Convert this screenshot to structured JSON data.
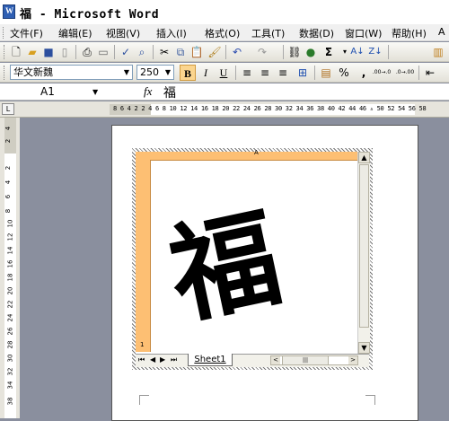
{
  "window": {
    "title": "福 - Microsoft Word"
  },
  "menu": [
    "文件(F)",
    "编辑(E)",
    "视图(V)",
    "插入(I)",
    "格式(O)",
    "工具(T)",
    "数据(D)",
    "窗口(W)",
    "帮助(H)",
    "A"
  ],
  "toolbar1": {
    "icons": [
      "new-icon",
      "open-icon",
      "save-icon",
      "permission-icon",
      "print-icon",
      "print-preview-icon",
      "spelling-icon",
      "research-icon",
      "cut-icon",
      "copy-icon",
      "paste-icon",
      "format-painter-icon",
      "undo-icon",
      "redo-icon",
      "hyperlink-icon",
      "map-icon",
      "autosum-icon",
      "sort-ascending-icon",
      "sort-descending-icon",
      "chart-icon"
    ],
    "autosum_label": "Σ"
  },
  "toolbar2": {
    "font_name": "华文新魏",
    "font_size": "250",
    "bold": "B",
    "italic": "I",
    "underline": "U",
    "percent": "%",
    "comma": ",",
    "inc_decimal": ".00→.0",
    "dec_decimal": ".0→.00"
  },
  "formula_bar": {
    "cell_ref": "A1",
    "fx": "fx",
    "value": "福"
  },
  "ruler": {
    "numbers": "8 6 4 2   2 4 6 8 10 12 14 16 18 20 22 24 26 28 30 32 34 36 38 40 42 44 46 ▵ 50 52 54 56 58"
  },
  "vruler": {
    "numbers": [
      "4",
      "2",
      "",
      "2",
      "4",
      "6",
      "8",
      "10",
      "12",
      "14",
      "16",
      "18",
      "20",
      "22",
      "24",
      "26",
      "28",
      "30",
      "32",
      "34",
      "36",
      "38"
    ]
  },
  "sheet": {
    "col_header": "A",
    "row_header": "1",
    "cell_text": "福",
    "tab_label": "Sheet1",
    "nav": [
      "⏮",
      "◀",
      "▶",
      "⏭"
    ],
    "scroll_up": "▲",
    "scroll_down": "▼",
    "scroll_left": "<",
    "scroll_right": ">",
    "thumb_grip": "|||"
  }
}
